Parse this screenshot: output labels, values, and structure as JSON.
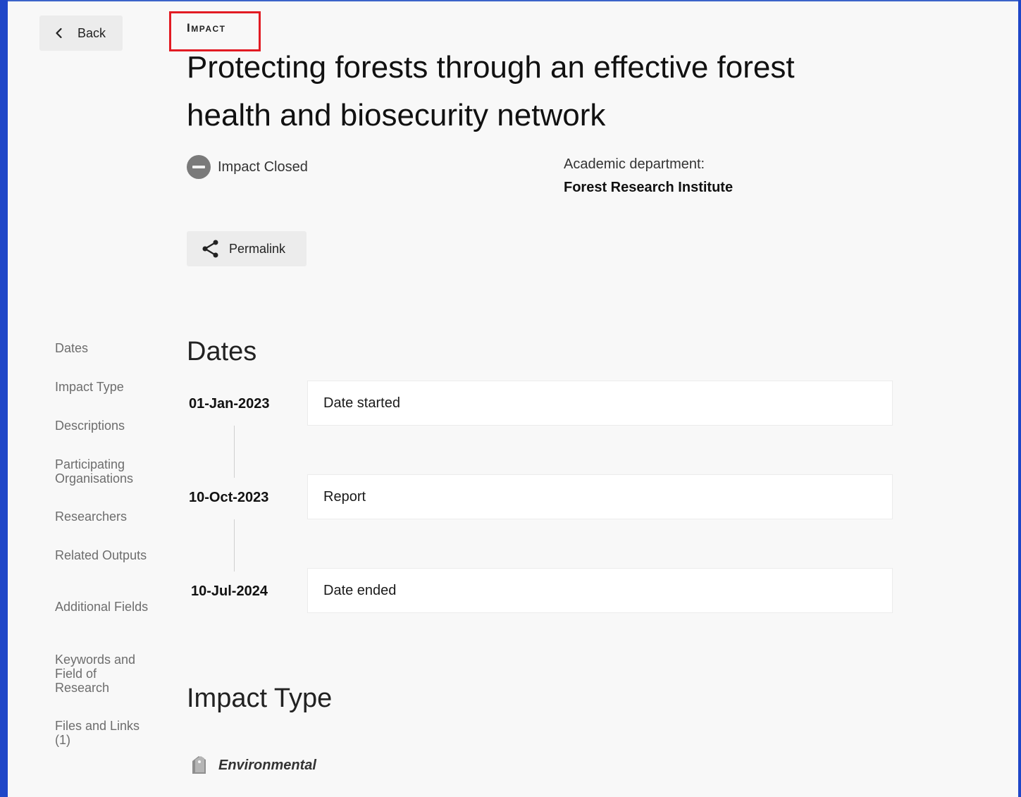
{
  "nav": {
    "back_label": "Back"
  },
  "header": {
    "category_label": "Impact",
    "title": "Protecting forests through an effective forest health and biosecurity network",
    "status": "Impact Closed",
    "department_label": "Academic department:",
    "department_value": "Forest Research Institute",
    "permalink_label": "Permalink"
  },
  "sidebar": {
    "items": [
      "Dates",
      "Impact Type",
      "Descriptions",
      "Participating Organisations",
      "Researchers",
      "Related Outputs",
      "Additional Fields",
      "Keywords and Field of Research",
      "Files and Links (1)"
    ]
  },
  "dates": {
    "heading": "Dates",
    "entries": [
      {
        "date": "01-Jan-2023",
        "label": "Date started"
      },
      {
        "date": "10-Oct-2023",
        "label": "Report"
      },
      {
        "date": "10-Jul-2024",
        "label": "Date ended"
      }
    ]
  },
  "impact_type": {
    "heading": "Impact Type",
    "value": "Environmental",
    "icon": "tag-icon"
  },
  "colors": {
    "accent_blue": "#1f47c8",
    "highlight_red": "#e21b23",
    "status_grey": "#7a7a7a"
  }
}
